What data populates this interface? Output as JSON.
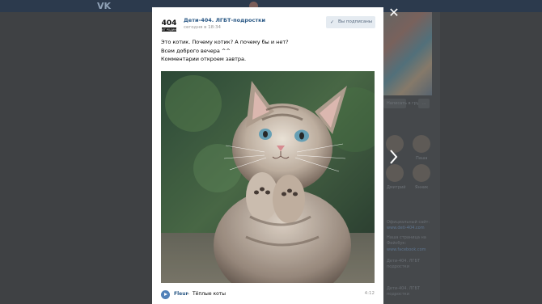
{
  "topbar": {
    "logo": "VK"
  },
  "background": {
    "buttons": [
      "",
      "",
      "..."
    ],
    "write_label": "Написать в группу",
    "members_label": "",
    "friends": [
      "",
      "Паша",
      "Дмитрий",
      "Янник"
    ],
    "info_lines": [
      "Официальный сайт:",
      "www.deti-404.com",
      "Наша страница на",
      "Фейсбук:",
      "www.facebook.com",
      "Дети-404. ЛГБТ",
      "подростки",
      "Дети-404. ЛГБТ",
      "подростки"
    ]
  },
  "modal": {
    "close_icon": "close-icon",
    "group": {
      "logo_text": "404",
      "logo_sub": "НЕТ РОДИНГ",
      "name": "Дети-404. ЛГБТ-подростки",
      "time": "сегодня в 18:34",
      "subscribed_label": "Вы подписаны"
    },
    "post_text": [
      "Это котик. Почему котик? А почему бы и нет?",
      "Всем доброго вечера ^^",
      "Комментарии откроем завтра."
    ],
    "audio": {
      "artist": "Fleur",
      "separator": "–",
      "title": "Тёплые коты",
      "duration": "4:12"
    }
  },
  "colors": {
    "link": "#2a5885",
    "accent": "#5181b8",
    "subscribed_bg": "#e5ebf1"
  }
}
